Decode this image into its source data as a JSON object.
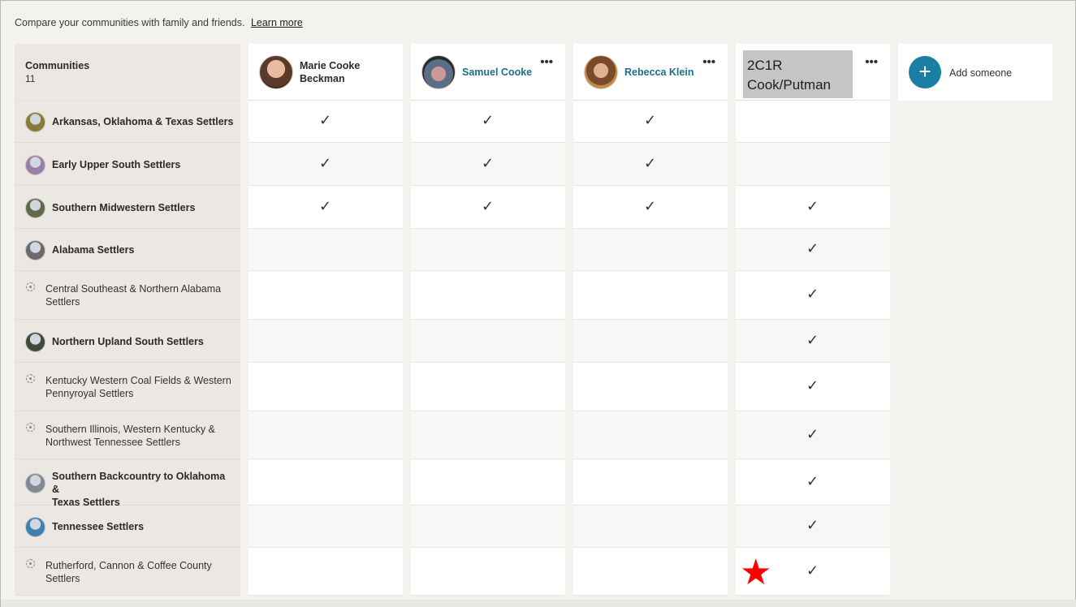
{
  "intro": {
    "text": "Compare your communities with family and friends.",
    "link": "Learn more"
  },
  "left_header": {
    "title": "Communities",
    "count": "11"
  },
  "people": [
    {
      "name_line1": "Marie Cooke",
      "name_line2": "Beckman"
    },
    {
      "name": "Samuel Cooke"
    },
    {
      "name": "Rebecca Klein"
    },
    {
      "box_line1": "2C1R",
      "box_line2": "Cook/Putman"
    }
  ],
  "add_someone": "Add someone",
  "communities": [
    {
      "name": "Arkansas, Oklahoma & Texas Settlers",
      "style": "bold",
      "thumb": "#8a7a3a",
      "checks": [
        true,
        true,
        true,
        false
      ]
    },
    {
      "name": "Early Upper South Settlers",
      "style": "bold",
      "thumb": "#9a7fa8",
      "checks": [
        true,
        true,
        true,
        false
      ]
    },
    {
      "name": "Southern Midwestern Settlers",
      "style": "bold",
      "thumb": "#5f6a4a",
      "checks": [
        true,
        true,
        true,
        true
      ]
    },
    {
      "name": "Alabama Settlers",
      "style": "bold",
      "thumb": "#6b6b6b",
      "checks": [
        false,
        false,
        false,
        true
      ]
    },
    {
      "name_line1": "Central Southeast & Northern Alabama",
      "name_line2": "Settlers",
      "style": "light",
      "checks": [
        false,
        false,
        false,
        true
      ]
    },
    {
      "name": "Northern Upland South Settlers",
      "style": "bold",
      "thumb": "#3f4a3a",
      "checks": [
        false,
        false,
        false,
        true
      ]
    },
    {
      "name_line1": "Kentucky Western Coal Fields & Western",
      "name_line2": "Pennyroyal Settlers",
      "style": "light",
      "checks": [
        false,
        false,
        false,
        true
      ]
    },
    {
      "name_line1": "Southern Illinois, Western Kentucky &",
      "name_line2": "Northwest Tennessee Settlers",
      "style": "light",
      "checks": [
        false,
        false,
        false,
        true
      ]
    },
    {
      "name_line1": "Southern Backcountry to Oklahoma &",
      "name_line2": "Texas Settlers",
      "style": "bold",
      "thumb": "#7f8a96",
      "checks": [
        false,
        false,
        false,
        true
      ]
    },
    {
      "name": "Tennessee Settlers",
      "style": "bold",
      "thumb": "#3d7fb0",
      "checks": [
        false,
        false,
        false,
        true
      ]
    },
    {
      "name_line1": "Rutherford, Cannon & Coffee County",
      "name_line2": "Settlers",
      "style": "light",
      "checks": [
        false,
        false,
        false,
        true
      ]
    }
  ],
  "check_glyph": "✓",
  "more_glyph": "•••",
  "star_glyph": "★",
  "colors": {
    "accent": "#1a7fa3",
    "link": "#1a6f8a",
    "star": "#ff0000"
  }
}
